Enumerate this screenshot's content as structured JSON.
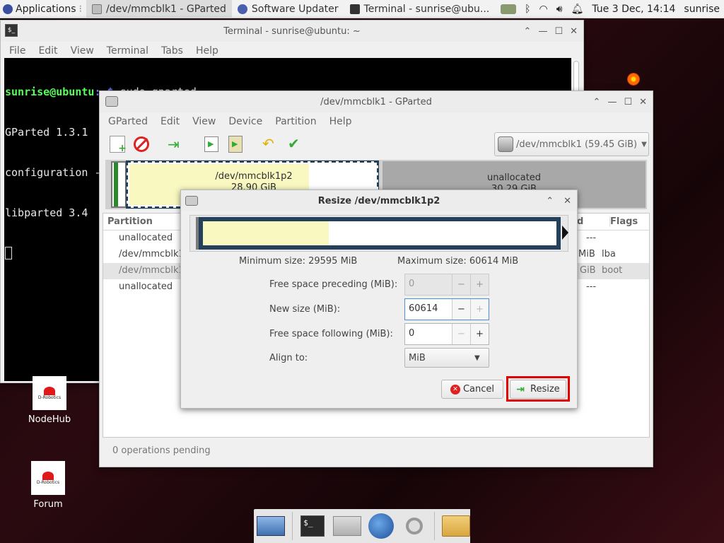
{
  "panel": {
    "applications_label": "Applications",
    "tasks": [
      {
        "label": "/dev/mmcblk1 - GParted"
      },
      {
        "label": "Software Updater"
      },
      {
        "label": "Terminal - sunrise@ubu..."
      }
    ],
    "clock": "Tue  3 Dec, 14:14",
    "user": "sunrise"
  },
  "terminal": {
    "title": "Terminal - sunrise@ubuntu: ~",
    "menu": [
      "File",
      "Edit",
      "View",
      "Terminal",
      "Tabs",
      "Help"
    ],
    "prompt_user": "sunrise@ubuntu",
    "prompt_path": ":~$ ",
    "command": "sudo gparted",
    "lines": [
      "GParted 1.3.1",
      "configuration --enable-libparted-dmraid --enable-online-resize",
      "libparted 3.4"
    ]
  },
  "gparted": {
    "title": "/dev/mmcblk1 - GParted",
    "menu": [
      "GParted",
      "Edit",
      "View",
      "Device",
      "Partition",
      "Help"
    ],
    "device_selector": "/dev/mmcblk1 (59.45 GiB)",
    "map": {
      "p2_name": "/dev/mmcblk1p2",
      "p2_size": "28.90 GiB",
      "unalloc_name": "unallocated",
      "unalloc_size": "30.29 GiB"
    },
    "columns": {
      "partition": "Partition",
      "used": "d",
      "flags": "Flags"
    },
    "rows": [
      {
        "partition": "unallocated",
        "used": "",
        "flags": "---"
      },
      {
        "partition": "/dev/mmcblk1",
        "used": "MiB",
        "flags": "lba"
      },
      {
        "partition": "/dev/mmcblk1",
        "used": "GiB",
        "flags": "boot"
      },
      {
        "partition": "unallocated",
        "used": "",
        "flags": "---"
      }
    ],
    "status": "0 operations pending"
  },
  "resize_dialog": {
    "title": "Resize /dev/mmcblk1p2",
    "used_fraction": 0.355,
    "min_size": "Minimum size: 29595 MiB",
    "max_size": "Maximum size: 60614 MiB",
    "free_preceding_label": "Free space preceding (MiB):",
    "free_preceding_value": "0",
    "new_size_label": "New size (MiB):",
    "new_size_value": "60614",
    "free_following_label": "Free space following (MiB):",
    "free_following_value": "0",
    "align_label": "Align to:",
    "align_value": "MiB",
    "cancel_label": "Cancel",
    "resize_label": "Resize"
  },
  "desktop_icons": [
    {
      "label": "NodeHub",
      "logo_text": "D-Robotics"
    },
    {
      "label": "Forum",
      "logo_text": "D-Robotics"
    }
  ],
  "colors": {
    "panel_bg": "#f2f2f2",
    "terminal_bg": "#000000",
    "prompt_green": "#55ff55",
    "prompt_blue": "#5c5cff",
    "partition_used": "#f8f8c0",
    "unallocated": "#a8a8a8",
    "highlight_red": "#e00000",
    "resize_bar_dark": "#23415a"
  }
}
